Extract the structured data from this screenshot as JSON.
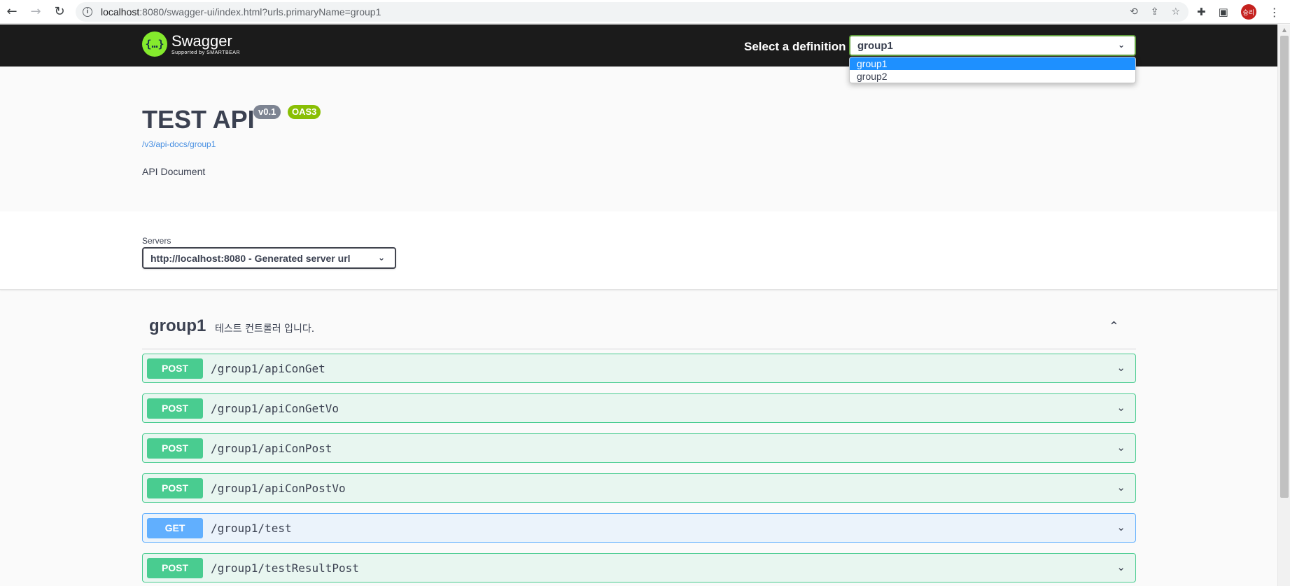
{
  "browser": {
    "back_icon": "arrow-left-icon",
    "forward_icon": "arrow-right-icon",
    "reload_icon": "reload-icon",
    "url_host": "localhost",
    "url_rest": ":8080/swagger-ui/index.html?urls.primaryName=group1",
    "profile_initials": "승리"
  },
  "topbar": {
    "logo_glyph": "{…}",
    "logo_title": "Swagger",
    "logo_subtitle": "Supported by SMARTBEAR",
    "definition_label": "Select a definition",
    "definition_value": "group1",
    "definition_options": [
      "group1",
      "group2"
    ],
    "accent_color": "#85ea2d"
  },
  "info": {
    "title": "TEST API",
    "version": "v0.1",
    "oas_badge": "OAS3",
    "spec_url": "/v3/api-docs/group1",
    "description": "API Document"
  },
  "servers": {
    "label": "Servers",
    "selected": "http://localhost:8080 - Generated server url"
  },
  "tag": {
    "name": "group1",
    "description": "테스트 컨트롤러 입니다."
  },
  "operations": [
    {
      "method": "POST",
      "path": "/group1/apiConGet"
    },
    {
      "method": "POST",
      "path": "/group1/apiConGetVo"
    },
    {
      "method": "POST",
      "path": "/group1/apiConPost"
    },
    {
      "method": "POST",
      "path": "/group1/apiConPostVo"
    },
    {
      "method": "GET",
      "path": "/group1/test"
    },
    {
      "method": "POST",
      "path": "/group1/testResultPost"
    }
  ],
  "colors": {
    "post": "#49cc90",
    "get": "#61affe",
    "topbar_bg": "#1b1b1b"
  }
}
